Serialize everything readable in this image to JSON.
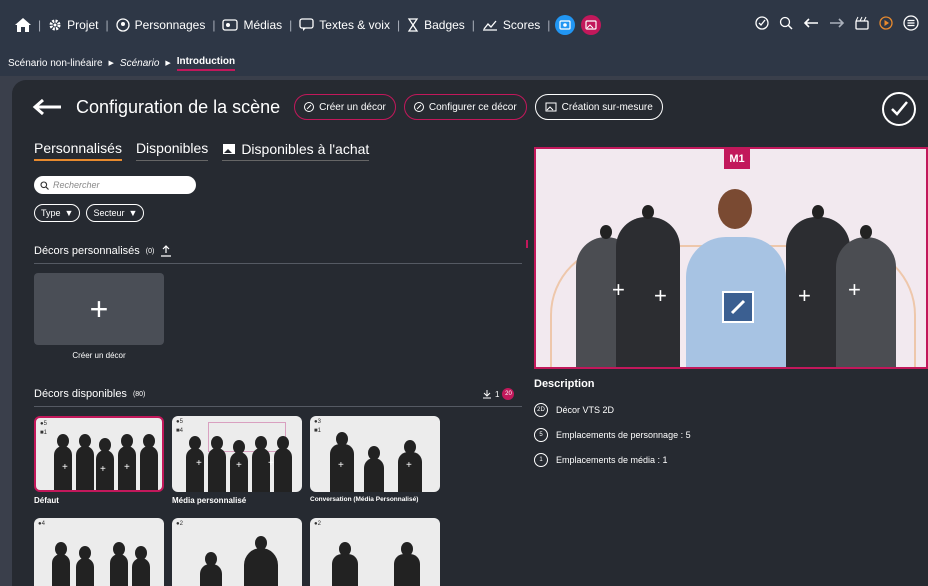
{
  "topnav": {
    "items": [
      {
        "label": "Projet",
        "icon": "gear-icon"
      },
      {
        "label": "Personnages",
        "icon": "character-icon"
      },
      {
        "label": "Médias",
        "icon": "media-icon"
      },
      {
        "label": "Textes & voix",
        "icon": "speech-icon"
      },
      {
        "label": "Badges",
        "icon": "badge-icon"
      },
      {
        "label": "Scores",
        "icon": "chart-icon"
      }
    ],
    "colors": {
      "blue": "#2196f3",
      "magenta": "#c2185b",
      "orange": "#e88a2e"
    }
  },
  "breadcrumb": {
    "root": "Scénario non-linéaire",
    "mid": "Scénario",
    "current": "Introduction"
  },
  "header": {
    "title": "Configuration de la scène",
    "create_label": "Créer un décor",
    "configure_label": "Configurer ce décor",
    "custom_label": "Création sur-mesure"
  },
  "tabs": {
    "t1": "Personnalisés",
    "t2": "Disponibles",
    "t3": "Disponibles à l'achat"
  },
  "search": {
    "placeholder": "Rechercher"
  },
  "filters": {
    "type": "Type",
    "sector": "Secteur"
  },
  "custom_section": {
    "label": "Décors personnalisés",
    "count": "(0)"
  },
  "create_tile": {
    "caption": "Créer un décor"
  },
  "available_section": {
    "label": "Décors disponibles",
    "count": "(80)",
    "download_count": "1",
    "badge": "20"
  },
  "cards": [
    {
      "label": "Défaut"
    },
    {
      "label": "Média personnalisé"
    },
    {
      "label": "Conversation (Média Personnalisé)"
    }
  ],
  "preview": {
    "marker": "M1"
  },
  "description": {
    "title": "Description",
    "row1": "Décor VTS 2D",
    "row2": "Emplacements de personnage : 5",
    "row3": "Emplacements de média : 1",
    "badge1": "2D",
    "badge2": "5",
    "badge3": "1"
  }
}
